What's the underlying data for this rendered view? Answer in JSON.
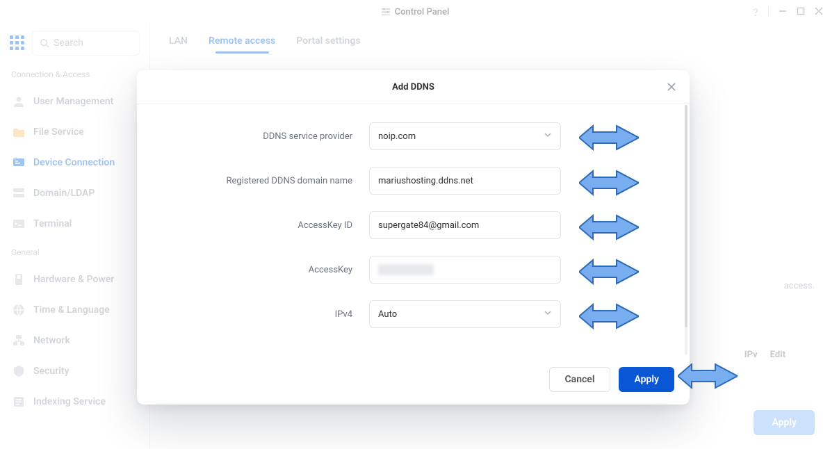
{
  "window": {
    "title": "Control Panel"
  },
  "sidebar": {
    "search_placeholder": "Search",
    "section_connection": "Connection & Access",
    "section_general": "General",
    "items_connection": [
      {
        "label": "User Management"
      },
      {
        "label": "File Service"
      },
      {
        "label": "Device Connection"
      },
      {
        "label": "Domain/LDAP"
      },
      {
        "label": "Terminal"
      }
    ],
    "items_general": [
      {
        "label": "Hardware & Power"
      },
      {
        "label": "Time & Language"
      },
      {
        "label": "Network"
      },
      {
        "label": "Security"
      },
      {
        "label": "Indexing Service"
      }
    ]
  },
  "tabs": {
    "lan": "LAN",
    "remote_access": "Remote access",
    "portal_settings": "Portal settings"
  },
  "background": {
    "peek_text": "access.",
    "col_ipv": "IPv",
    "col_edit": "Edit",
    "apply_label": "Apply"
  },
  "modal": {
    "title": "Add DDNS",
    "labels": {
      "provider": "DDNS service provider",
      "domain": "Registered DDNS domain name",
      "access_key_id": "AccessKey ID",
      "access_key": "AccessKey",
      "ipv4": "IPv4"
    },
    "values": {
      "provider": "noip.com",
      "domain": "mariushosting.ddns.net",
      "access_key_id": "supergate84@gmail.com",
      "ipv4": "Auto"
    },
    "buttons": {
      "cancel": "Cancel",
      "apply": "Apply"
    }
  }
}
